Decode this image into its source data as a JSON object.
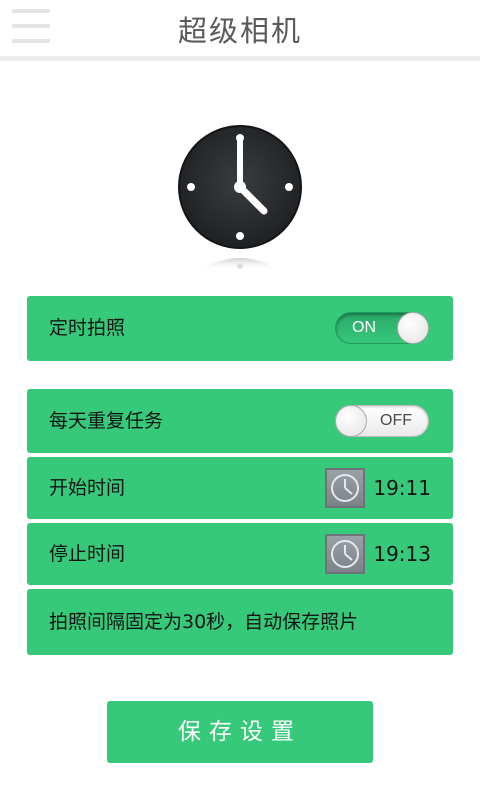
{
  "header": {
    "title": "超级相机",
    "menu_icon": "menu-icon"
  },
  "hero": {
    "icon": "clock-icon"
  },
  "timed_photo": {
    "label": "定时拍照",
    "toggle_text": "ON",
    "enabled": true
  },
  "repeat_daily": {
    "label": "每天重复任务",
    "toggle_text": "OFF",
    "enabled": false
  },
  "start_time": {
    "label": "开始时间",
    "value": "19:11",
    "icon": "clock-icon"
  },
  "stop_time": {
    "label": "停止时间",
    "value": "19:13",
    "icon": "clock-icon"
  },
  "note": "拍照间隔固定为30秒，自动保存照片",
  "save_button": "保存设置",
  "colors": {
    "accent": "#37c97a",
    "title_text": "#5a5a5a",
    "button_text": "#ffffff"
  }
}
